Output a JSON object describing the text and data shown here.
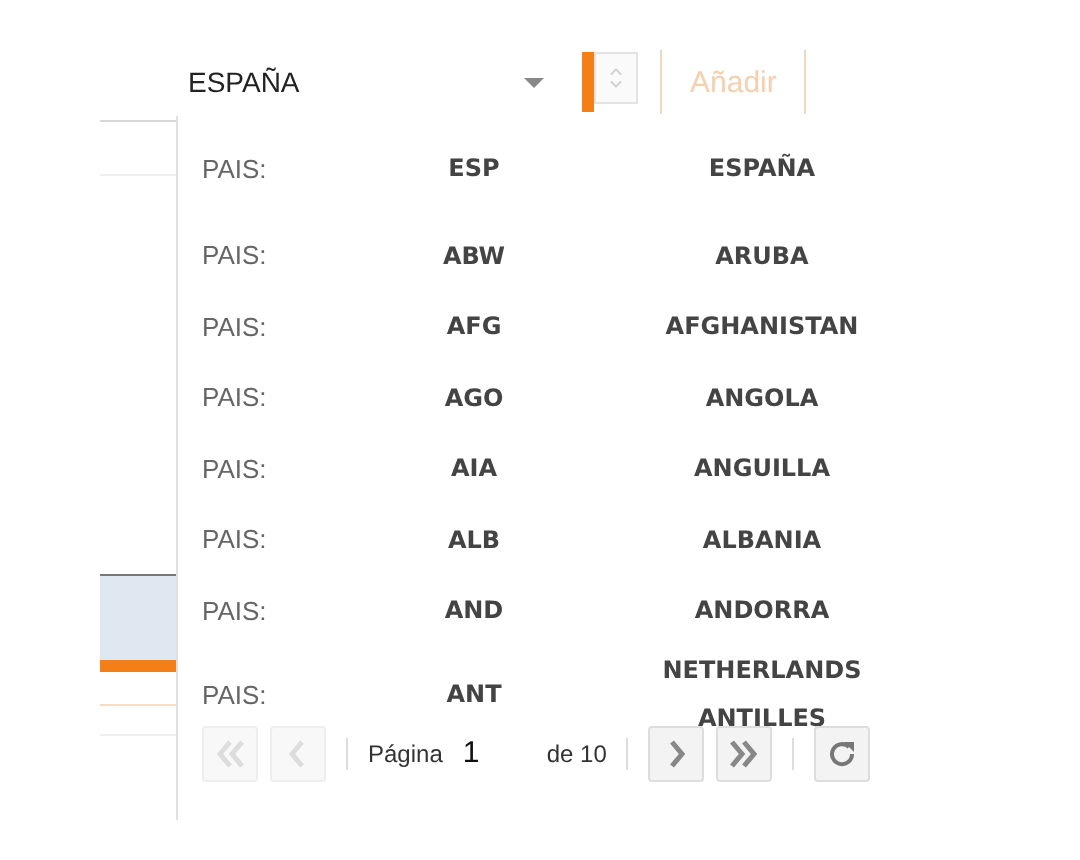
{
  "combo": {
    "value": "ESPAÑA"
  },
  "add_button": {
    "label": "Añadir",
    "disabled": true
  },
  "options": [
    {
      "label": "PAIS:",
      "code": "ESP",
      "name": "ESPAÑA"
    },
    {
      "label": "PAIS:",
      "code": "ABW",
      "name": "ARUBA"
    },
    {
      "label": "PAIS:",
      "code": "AFG",
      "name": "AFGHANISTAN"
    },
    {
      "label": "PAIS:",
      "code": "AGO",
      "name": "ANGOLA"
    },
    {
      "label": "PAIS:",
      "code": "AIA",
      "name": "ANGUILLA"
    },
    {
      "label": "PAIS:",
      "code": "ALB",
      "name": "ALBANIA"
    },
    {
      "label": "PAIS:",
      "code": "AND",
      "name": "ANDORRA"
    },
    {
      "label": "PAIS:",
      "code": "ANT",
      "name": "NETHERLANDS ANTILLES"
    }
  ],
  "pager": {
    "first_disabled": true,
    "prev_disabled": true,
    "page_label": "Página",
    "page": "1",
    "total": "de 10",
    "next_disabled": false,
    "last_disabled": false
  }
}
